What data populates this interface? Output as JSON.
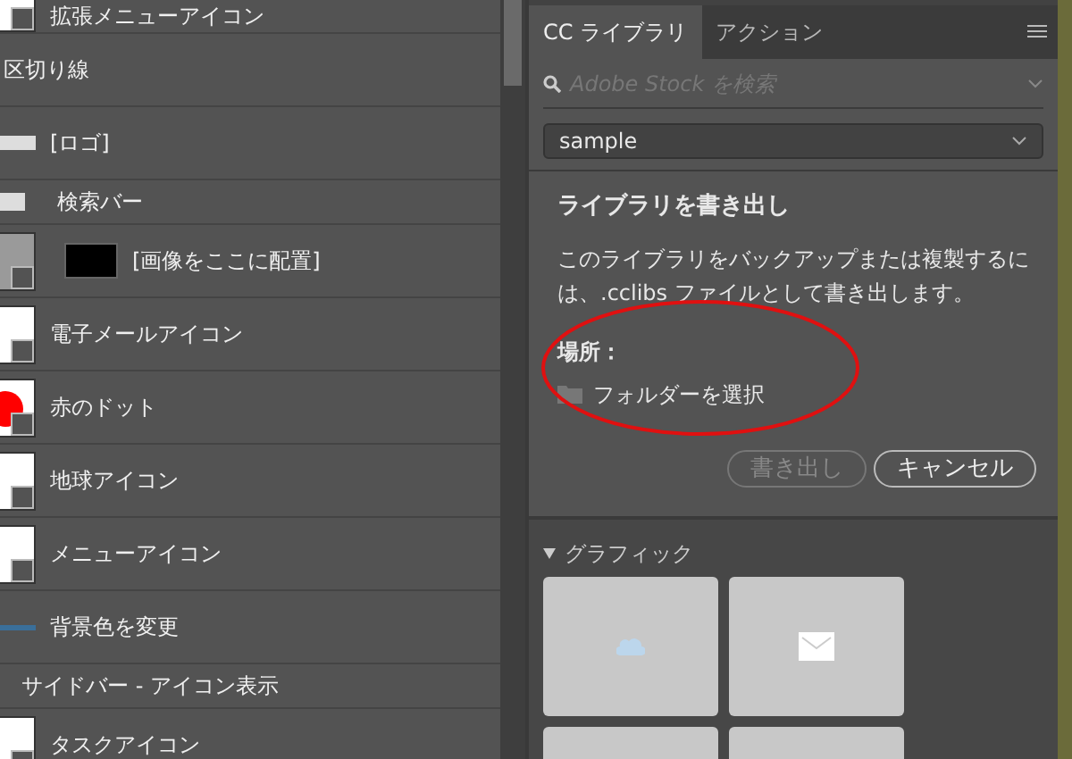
{
  "layers": [
    {
      "name": "拡張メニューアイコン",
      "kind": "shape"
    },
    {
      "name": "区切り線",
      "kind": "plain"
    },
    {
      "name": "[ロゴ]",
      "kind": "logo"
    },
    {
      "name": "検索バー",
      "kind": "folder"
    },
    {
      "name": "[画像をここに配置]",
      "kind": "placeholder"
    },
    {
      "name": "電子メールアイコン",
      "kind": "shape"
    },
    {
      "name": "赤のドット",
      "kind": "dot"
    },
    {
      "name": "地球アイコン",
      "kind": "shape"
    },
    {
      "name": "メニューアイコン",
      "kind": "shape"
    },
    {
      "name": "背景色を変更",
      "kind": "line"
    },
    {
      "name": "サイドバー - アイコン表示",
      "kind": "group"
    },
    {
      "name": "タスクアイコン",
      "kind": "shape"
    }
  ],
  "panel": {
    "tabs": [
      {
        "label": "CC ライブラリ",
        "selected": true
      },
      {
        "label": "アクション",
        "selected": false
      }
    ],
    "search": {
      "placeholder": "Adobe Stock を検索"
    },
    "library": {
      "value": "sample"
    },
    "export_dialog": {
      "title": "ライブラリを書き出し",
      "description": "このライブラリをバックアップまたは複製するには、.cclibs ファイルとして書き出します。",
      "location_label": "場所：",
      "folder_link": "フォルダーを選択",
      "buttons": [
        {
          "label": "書き出し",
          "disabled": true
        },
        {
          "label": "キャンセル",
          "disabled": false
        }
      ]
    },
    "annotations": [
      {
        "kind": "ellipse"
      }
    ],
    "section": {
      "title": "グラフィック",
      "expanded": true,
      "tiles": [
        {
          "kind": "cloud"
        },
        {
          "kind": "envelope"
        },
        {
          "kind": "blank"
        },
        {
          "kind": "blank"
        }
      ]
    }
  }
}
